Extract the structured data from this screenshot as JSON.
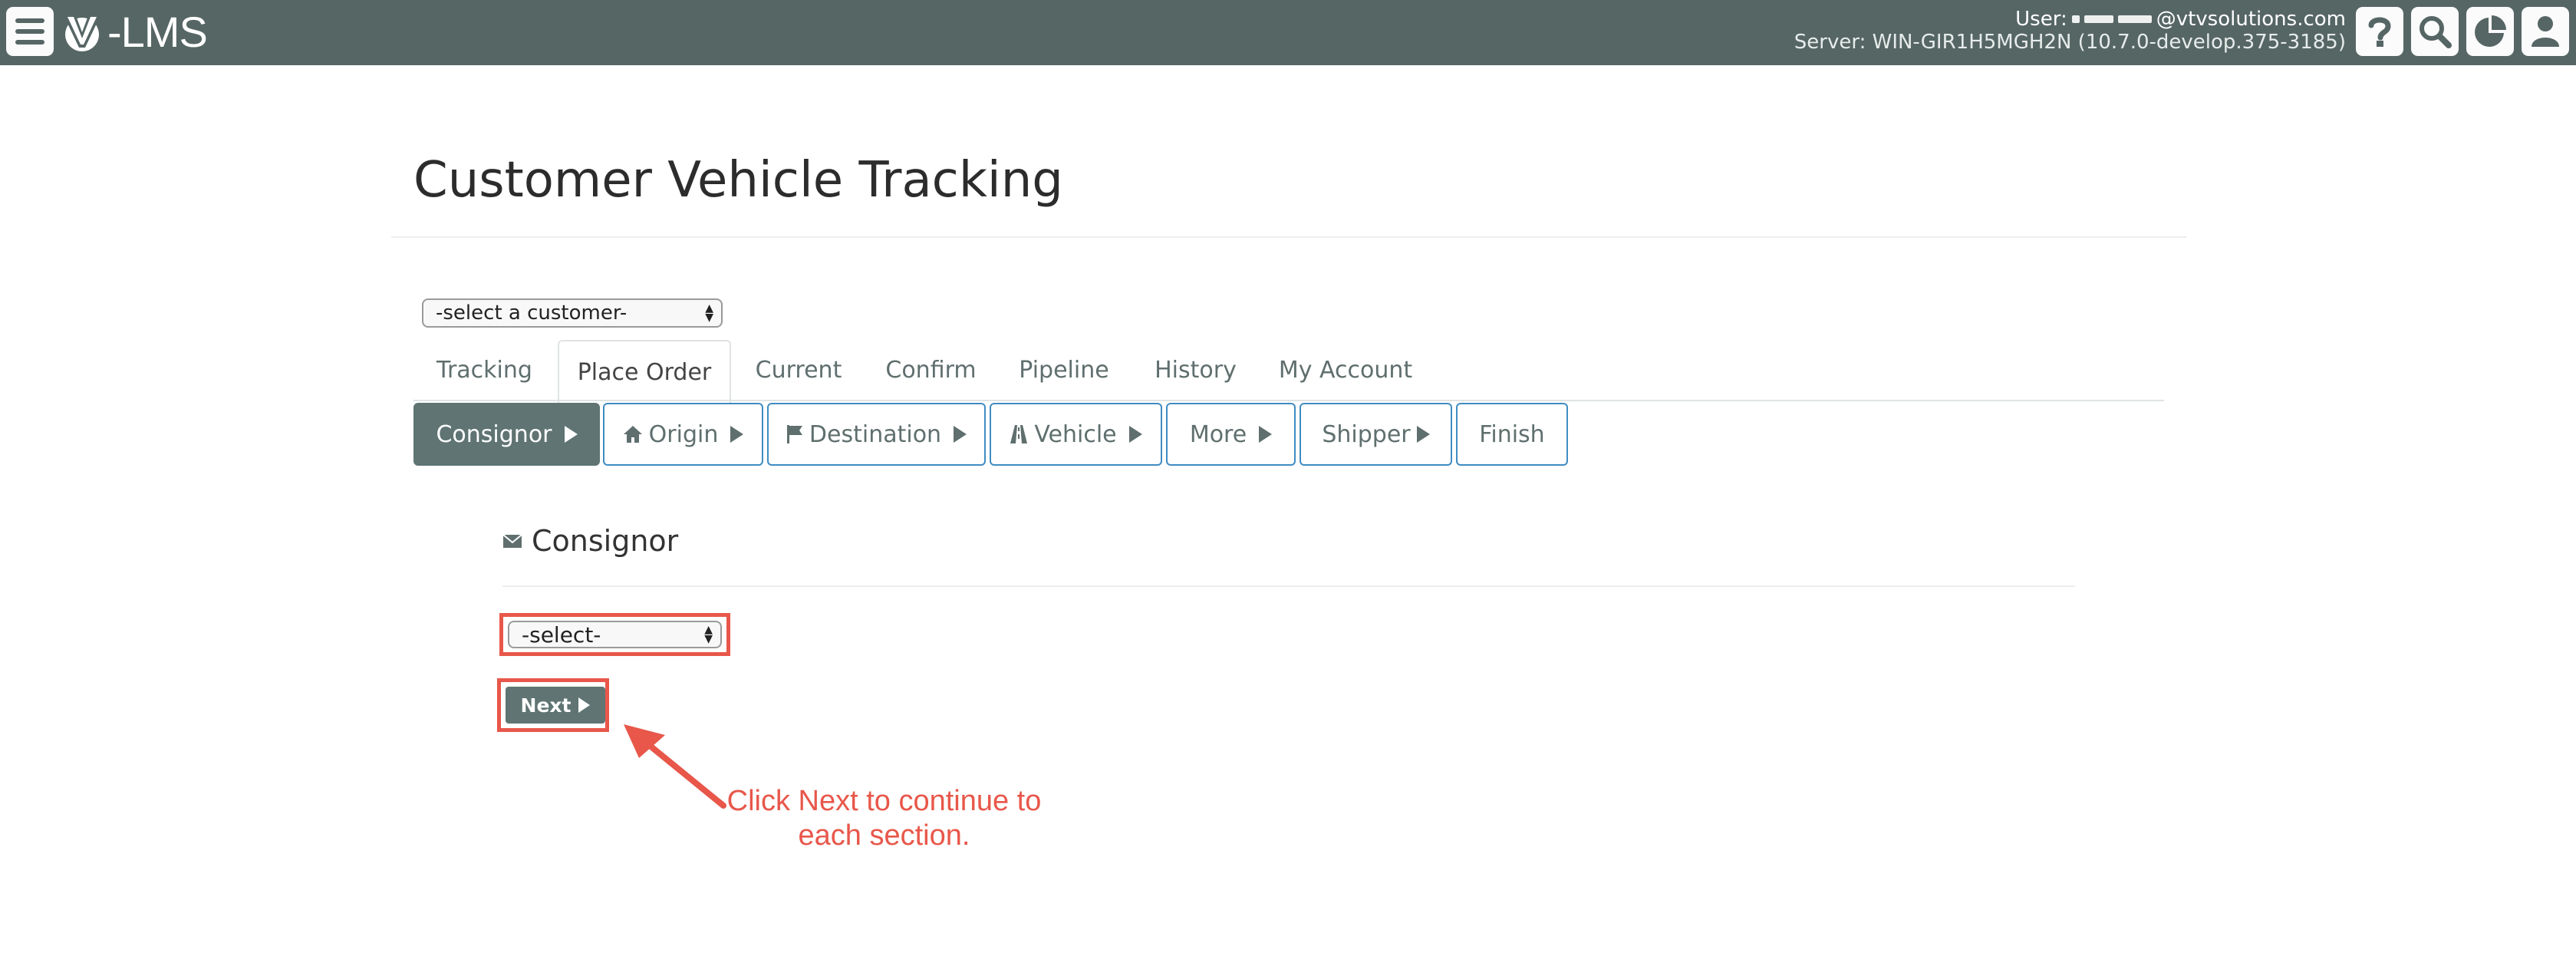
{
  "header": {
    "app_name": "-LMS",
    "user_label": "User:",
    "user_email_suffix": "@vtvsolutions.com",
    "server_line": "Server: WIN-GIR1H5MGH2N (10.7.0-develop.375-3185)",
    "icons": [
      "menu-icon",
      "help-icon",
      "search-icon",
      "pie-chart-icon",
      "user-icon"
    ]
  },
  "page": {
    "title": "Customer Vehicle Tracking",
    "customer_select": {
      "value": "-select a customer-"
    }
  },
  "tabs": [
    {
      "label": "Tracking"
    },
    {
      "label": "Place Order",
      "active": true
    },
    {
      "label": "Current"
    },
    {
      "label": "Confirm"
    },
    {
      "label": "Pipeline"
    },
    {
      "label": "History"
    },
    {
      "label": "My Account"
    }
  ],
  "steps": [
    {
      "label": "Consignor",
      "icon": "",
      "active": true
    },
    {
      "label": "Origin",
      "icon": "home-icon"
    },
    {
      "label": "Destination",
      "icon": "flag-icon"
    },
    {
      "label": "Vehicle",
      "icon": "road-icon"
    },
    {
      "label": "More",
      "icon": ""
    },
    {
      "label": "Shipper",
      "icon": ""
    },
    {
      "label": "Finish",
      "icon": ""
    }
  ],
  "section": {
    "title": "Consignor",
    "icon": "envelope-icon",
    "select_value": "-select-",
    "next_label": "Next"
  },
  "annotation": {
    "line1": "Click Next to continue to",
    "line2": "each section.",
    "color": "#e8574a"
  },
  "colors": {
    "topbar": "#566665",
    "active": "#5f7473",
    "step_border": "#3f8cc3",
    "highlight": "#e8574a"
  }
}
